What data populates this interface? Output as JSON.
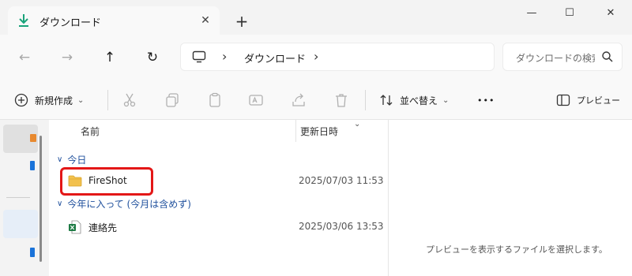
{
  "window": {
    "tab_title": "ダウンロード",
    "tab_close": "✕",
    "new_tab": "+",
    "minimize": "—",
    "maximize": "☐",
    "close": "✕"
  },
  "nav": {
    "back": "←",
    "forward": "→",
    "up": "↑",
    "refresh": "↻",
    "breadcrumb": [
      "ダウンロード"
    ],
    "sep": "›",
    "search_placeholder": "ダウンロードの検索"
  },
  "toolbar": {
    "new_label": "新規作成",
    "new_chevron": "⌄",
    "sort_label": "並べ替え",
    "sort_chevron": "⌄",
    "more": "•••",
    "preview_label": "プレビュー"
  },
  "columns": {
    "name": "名前",
    "modified": "更新日時",
    "sort_indicator": "⌄"
  },
  "groups": [
    {
      "label": "今日",
      "chevron": "∨",
      "items": [
        {
          "name": "FireShot",
          "date": "2025/07/03 11:53",
          "type": "folder-icon"
        }
      ]
    },
    {
      "label": "今年に入って (今月は含めず)",
      "chevron": "∨",
      "items": [
        {
          "name": "連絡先",
          "date": "2025/03/06 13:53",
          "type": "excel-file-icon"
        }
      ]
    }
  ],
  "preview": {
    "message": "プレビューを表示するファイルを選択します。"
  },
  "colors": {
    "accent": "#1a73d9",
    "group_text": "#1e4f9c",
    "highlight": "#e31717",
    "folder": "#f2c14e",
    "excel": "#1d7a44"
  }
}
